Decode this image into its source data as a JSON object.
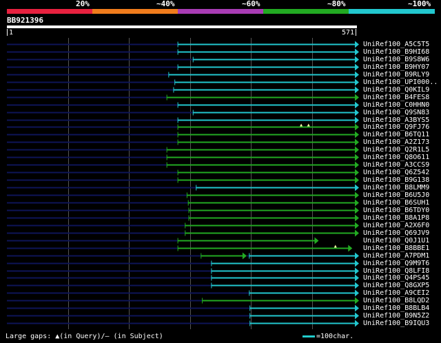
{
  "legend": {
    "segments": [
      {
        "color": "#e8213f",
        "label": "20%"
      },
      {
        "color": "#f07c1c",
        "label": "~40%"
      },
      {
        "color": "#a83cb4",
        "label": "~60%"
      },
      {
        "color": "#22aa22",
        "label": "~80%"
      },
      {
        "color": "#22c7cf",
        "label": "~100%"
      }
    ]
  },
  "query": {
    "id": "BB921396",
    "start_label": "1",
    "end_label": "571",
    "length": 571
  },
  "colors": {
    "cyan": "#22c7cf",
    "green": "#22aa22",
    "navy": "#0e1558",
    "grid": "#555555",
    "gap_marker": "#ffffaa"
  },
  "hits": [
    {
      "name": "UniRef100_A5C5T5",
      "start": 280,
      "color": "cyan"
    },
    {
      "name": "UniRef100_B9HI68",
      "start": 280,
      "color": "cyan"
    },
    {
      "name": "UniRef100_B9S8W6",
      "start": 305,
      "color": "cyan"
    },
    {
      "name": "UniRef100_B9HY07",
      "start": 280,
      "color": "cyan"
    },
    {
      "name": "UniRef100_B9RLY9",
      "start": 265,
      "color": "cyan"
    },
    {
      "name": "UniRef100_UPI000..",
      "start": 275,
      "color": "cyan"
    },
    {
      "name": "UniRef100_Q0KIL9",
      "start": 273,
      "color": "cyan"
    },
    {
      "name": "UniRef100_B4FES8",
      "start": 262,
      "color": "green"
    },
    {
      "name": "UniRef100_C0HHN0",
      "start": 280,
      "color": "cyan"
    },
    {
      "name": "UniRef100_Q9SN83",
      "start": 305,
      "color": "cyan"
    },
    {
      "name": "UniRef100_A3BYS5",
      "start": 280,
      "color": "cyan"
    },
    {
      "name": "UniRef100_Q9FJ76",
      "start": 280,
      "color": "green",
      "gap_marks": [
        482,
        494
      ]
    },
    {
      "name": "UniRef100_B6TQ11",
      "start": 280,
      "color": "green"
    },
    {
      "name": "UniRef100_A2Z173",
      "start": 280,
      "color": "green"
    },
    {
      "name": "UniRef100_Q2R1L5",
      "start": 262,
      "color": "green"
    },
    {
      "name": "UniRef100_Q8O611",
      "start": 262,
      "color": "green"
    },
    {
      "name": "UniRef100_A3CCS9",
      "start": 262,
      "color": "green"
    },
    {
      "name": "UniRef100_Q6Z542",
      "start": 280,
      "color": "green"
    },
    {
      "name": "UniRef100_B9G138",
      "start": 280,
      "color": "green"
    },
    {
      "name": "UniRef100_B8LMM9",
      "start": 310,
      "color": "cyan"
    },
    {
      "name": "UniRef100_B6U5J0",
      "start": 295,
      "color": "green"
    },
    {
      "name": "UniRef100_B6SUH1",
      "start": 297,
      "color": "green"
    },
    {
      "name": "UniRef100_B6TDY0",
      "start": 298,
      "color": "green"
    },
    {
      "name": "UniRef100_B8A1P8",
      "start": 298,
      "color": "green"
    },
    {
      "name": "UniRef100_A2X6F0",
      "start": 292,
      "color": "green"
    },
    {
      "name": "UniRef100_Q69JV9",
      "start": 292,
      "color": "green"
    },
    {
      "name": "UniRef100_Q0J1U1",
      "start": 280,
      "end": 505,
      "color": "green"
    },
    {
      "name": "UniRef100_B8BBE1",
      "start": 280,
      "end": 560,
      "color": "green",
      "gap_marks": [
        538
      ]
    },
    {
      "name": "UniRef100_A7PDM1",
      "start": 318,
      "end": 387,
      "start2": 397,
      "color": "green",
      "color2": "cyan"
    },
    {
      "name": "UniRef100_Q9M9T6",
      "start": 335,
      "color": "cyan"
    },
    {
      "name": "UniRef100_Q8LFI8",
      "start": 335,
      "color": "cyan"
    },
    {
      "name": "UniRef100_Q4PS45",
      "start": 335,
      "color": "cyan"
    },
    {
      "name": "UniRef100_Q8GXP5",
      "start": 335,
      "color": "cyan"
    },
    {
      "name": "UniRef100_A9CEI2",
      "start": 397,
      "color": "cyan"
    },
    {
      "name": "UniRef100_B8LQD2",
      "start": 320,
      "color": "green"
    },
    {
      "name": "UniRef100_B8BLB4",
      "start": 398,
      "color": "cyan"
    },
    {
      "name": "UniRef100_B9N5Z2",
      "start": 398,
      "color": "cyan"
    },
    {
      "name": "UniRef100_B9IQU3",
      "start": 398,
      "color": "cyan"
    }
  ],
  "footer": {
    "large_gaps_text": "Large gaps: ▲(in Query)/— (in Subject)",
    "scale_text": "=100char."
  }
}
